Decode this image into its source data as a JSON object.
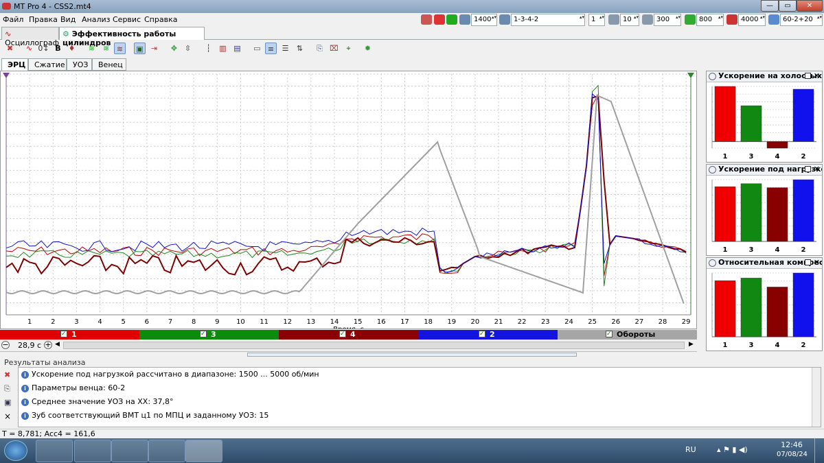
{
  "window": {
    "title": "MT Pro 4 - CSS2.mt4"
  },
  "menu": [
    "Файл",
    "Правка",
    "Вид",
    "Анализ",
    "Сервис",
    "Справка"
  ],
  "top_toolbar": {
    "rpm": "1400",
    "firing_order": "1-3-4-2",
    "cylinder": "1",
    "spin2": "10",
    "min_rpm": "300",
    "mid_rpm": "800",
    "max_rpm": "4000",
    "wheel": "60-2+20"
  },
  "doc_tabs": [
    "Осциллограф",
    "Эффективность работы цилиндров"
  ],
  "sub_tabs": [
    "ЭРЦ",
    "Сжатие",
    "УОЗ",
    "Венец"
  ],
  "chart_data": {
    "type": "line",
    "xlabel": "Время, с",
    "x_ticks": [
      1,
      2,
      3,
      4,
      5,
      6,
      7,
      8,
      9,
      10,
      11,
      12,
      13,
      14,
      15,
      16,
      17,
      18,
      19,
      20,
      21,
      22,
      23,
      24,
      25,
      26,
      27,
      28,
      29
    ],
    "xlim": [
      0,
      29.2
    ],
    "grid": true,
    "series": [
      {
        "name": "1",
        "color": "#c00000"
      },
      {
        "name": "3",
        "color": "#1a8a1a"
      },
      {
        "name": "4",
        "color": "#800000"
      },
      {
        "name": "2",
        "color": "#1010d0"
      },
      {
        "name": "Обороты",
        "color": "#a0a0a0"
      }
    ]
  },
  "legend": [
    {
      "label": "1",
      "color": "#e00000"
    },
    {
      "label": "3",
      "color": "#0b8a0b"
    },
    {
      "label": "4",
      "color": "#8b0000"
    },
    {
      "label": "2",
      "color": "#1414e0"
    },
    {
      "label": "Обороты",
      "color": "#a6a6a6"
    }
  ],
  "scroll": {
    "time": "28,9 с"
  },
  "panels": [
    {
      "title": "Ускорение на холостых",
      "chart_data": {
        "type": "bar",
        "categories": [
          "1",
          "3",
          "4",
          "2"
        ],
        "values": [
          1.0,
          0.65,
          -0.12,
          0.95
        ],
        "colors": [
          "#ee0000",
          "#118811",
          "#880000",
          "#1111ee"
        ]
      }
    },
    {
      "title": "Ускорение под нагрузкой",
      "chart_data": {
        "type": "bar",
        "categories": [
          "1",
          "3",
          "4",
          "2"
        ],
        "values": [
          0.55,
          0.58,
          0.54,
          0.62
        ],
        "colors": [
          "#ee0000",
          "#118811",
          "#880000",
          "#1111ee"
        ]
      }
    },
    {
      "title": "Относительная компрессия",
      "chart_data": {
        "type": "bar",
        "categories": [
          "1",
          "3",
          "4",
          "2"
        ],
        "values": [
          0.88,
          0.92,
          0.78,
          1.0
        ],
        "colors": [
          "#ee0000",
          "#118811",
          "#880000",
          "#1111ee"
        ]
      }
    }
  ],
  "results": {
    "label": "Результаты анализа",
    "items": [
      "Ускорение под нагрузкой рассчитано в диапазоне: 1500 ... 5000 об/мин",
      "Параметры венца: 60-2",
      "Среднее значение УОЗ на ХХ: 37,8°",
      "Зуб соответствующий ВМТ ц1 по МПЦ и заданному УОЗ: 15"
    ]
  },
  "status": "T = 8,781; Acc4 = 161,6",
  "taskbar": {
    "lang": "RU",
    "time": "12:46",
    "date": "07/08/24"
  }
}
